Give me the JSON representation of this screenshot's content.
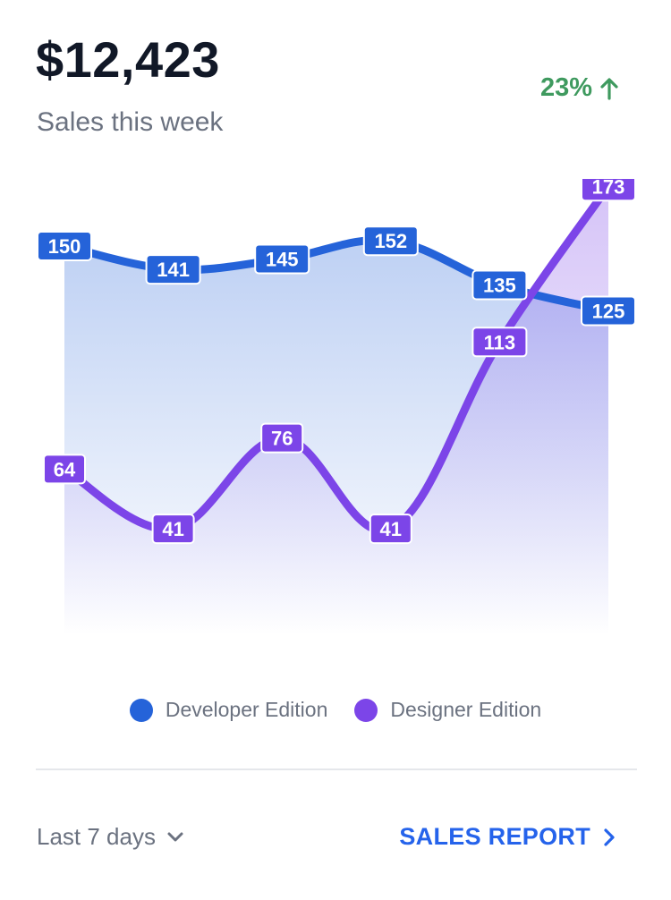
{
  "header": {
    "total": "$12,423",
    "subtitle": "Sales this week",
    "change": "23%",
    "change_icon": "arrow-up-icon",
    "change_color": "#3f9a5f"
  },
  "chart_data": {
    "type": "area",
    "ylim": [
      0,
      220
    ],
    "grid": false,
    "legend": "bottom-center",
    "series": [
      {
        "name": "Developer Edition",
        "color": "#2563d9",
        "values": [
          150,
          141,
          145,
          152,
          135,
          125
        ]
      },
      {
        "name": "Designer Edition",
        "color": "#7c45e8",
        "values": [
          64,
          41,
          76,
          41,
          113,
          173
        ]
      }
    ]
  },
  "footer": {
    "range_label": "Last 7 days",
    "range_icon": "chevron-down-icon",
    "report_label": "SALES REPORT",
    "report_icon": "chevron-right-icon",
    "report_color": "#2563eb"
  }
}
